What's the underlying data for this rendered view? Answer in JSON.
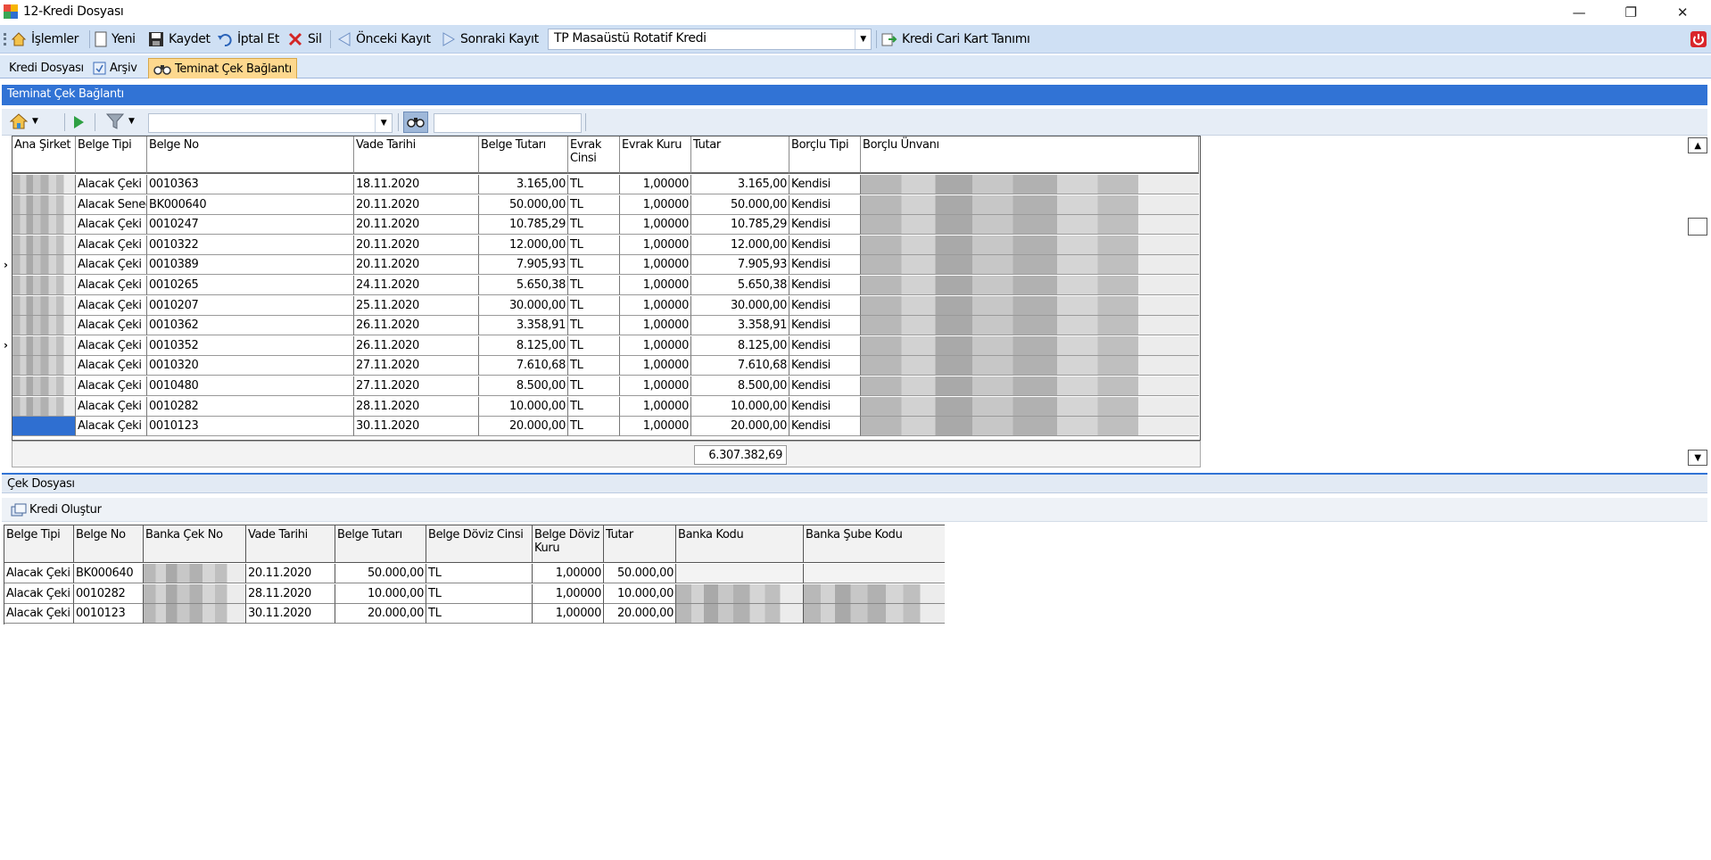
{
  "window": {
    "title": "12-Kredi Dosyası",
    "buttons": [
      "—",
      "❐",
      "✕"
    ]
  },
  "toolbar": {
    "menu": "İşlemler",
    "new": "Yeni",
    "save": "Kaydet",
    "cancel": "İptal Et",
    "delete": "Sil",
    "prev": "Önceki Kayıt",
    "next": "Sonraki Kayıt",
    "combo_value": "TP Masaüstü Rotatif Kredi",
    "card": "Kredi Cari Kart Tanımı"
  },
  "tabs": [
    "Kredi Dosyası",
    "Arşiv",
    "Teminat Çek Bağlantı"
  ],
  "section1": {
    "title": "Teminat Çek Bağlantı"
  },
  "grid1": {
    "columns": [
      "Ana Şirket",
      "Belge Tipi",
      "Belge No",
      "Vade Tarihi",
      "Belge Tutarı",
      "Evrak Cinsi",
      "Evrak Kuru",
      "Tutar",
      "Borçlu Tipi",
      "Borçlu Ünvanı"
    ],
    "rows": [
      [
        "",
        "Alacak Çeki",
        "0010363",
        "18.11.2020",
        "3.165,00",
        "TL",
        "1,00000",
        "3.165,00",
        "Kendisi",
        ""
      ],
      [
        "",
        "Alacak Senedi",
        "BK000640",
        "20.11.2020",
        "50.000,00",
        "TL",
        "1,00000",
        "50.000,00",
        "Kendisi",
        ""
      ],
      [
        "",
        "Alacak Çeki",
        "0010247",
        "20.11.2020",
        "10.785,29",
        "TL",
        "1,00000",
        "10.785,29",
        "Kendisi",
        ""
      ],
      [
        "",
        "Alacak Çeki",
        "0010322",
        "20.11.2020",
        "12.000,00",
        "TL",
        "1,00000",
        "12.000,00",
        "Kendisi",
        ""
      ],
      [
        "",
        "Alacak Çeki",
        "0010389",
        "20.11.2020",
        "7.905,93",
        "TL",
        "1,00000",
        "7.905,93",
        "Kendisi",
        ""
      ],
      [
        "",
        "Alacak Çeki",
        "0010265",
        "24.11.2020",
        "5.650,38",
        "TL",
        "1,00000",
        "5.650,38",
        "Kendisi",
        ""
      ],
      [
        "",
        "Alacak Çeki",
        "0010207",
        "25.11.2020",
        "30.000,00",
        "TL",
        "1,00000",
        "30.000,00",
        "Kendisi",
        ""
      ],
      [
        "",
        "Alacak Çeki",
        "0010362",
        "26.11.2020",
        "3.358,91",
        "TL",
        "1,00000",
        "3.358,91",
        "Kendisi",
        ""
      ],
      [
        "",
        "Alacak Çeki",
        "0010352",
        "26.11.2020",
        "8.125,00",
        "TL",
        "1,00000",
        "8.125,00",
        "Kendisi",
        ""
      ],
      [
        "",
        "Alacak Çeki",
        "0010320",
        "27.11.2020",
        "7.610,68",
        "TL",
        "1,00000",
        "7.610,68",
        "Kendisi",
        ""
      ],
      [
        "",
        "Alacak Çeki",
        "0010480",
        "27.11.2020",
        "8.500,00",
        "TL",
        "1,00000",
        "8.500,00",
        "Kendisi",
        ""
      ],
      [
        "",
        "Alacak Çeki",
        "0010282",
        "28.11.2020",
        "10.000,00",
        "TL",
        "1,00000",
        "10.000,00",
        "Kendisi",
        ""
      ],
      [
        "",
        "Alacak Çeki",
        "0010123",
        "30.11.2020",
        "20.000,00",
        "TL",
        "1,00000",
        "20.000,00",
        "Kendisi",
        ""
      ]
    ],
    "total": "6.307.382,69"
  },
  "section2": {
    "title": "Çek Dosyası",
    "create_button": "Kredi Oluştur"
  },
  "grid2": {
    "columns": [
      "Belge Tipi",
      "Belge No",
      "Banka Çek No",
      "Vade Tarihi",
      "Belge Tutarı",
      "Belge Döviz Cinsi",
      "Belge Döviz Kuru",
      "Tutar",
      "Banka Kodu",
      "Banka Şube Kodu"
    ],
    "rows": [
      [
        "Alacak Çeki",
        "BK000640",
        "",
        "20.11.2020",
        "50.000,00",
        "TL",
        "1,00000",
        "50.000,00",
        "",
        ""
      ],
      [
        "Alacak Çeki",
        "0010282",
        "",
        "28.11.2020",
        "10.000,00",
        "TL",
        "1,00000",
        "10.000,00",
        "",
        ""
      ],
      [
        "Alacak Çeki",
        "0010123",
        "",
        "30.11.2020",
        "20.000,00",
        "TL",
        "1,00000",
        "20.000,00",
        "",
        ""
      ]
    ]
  }
}
